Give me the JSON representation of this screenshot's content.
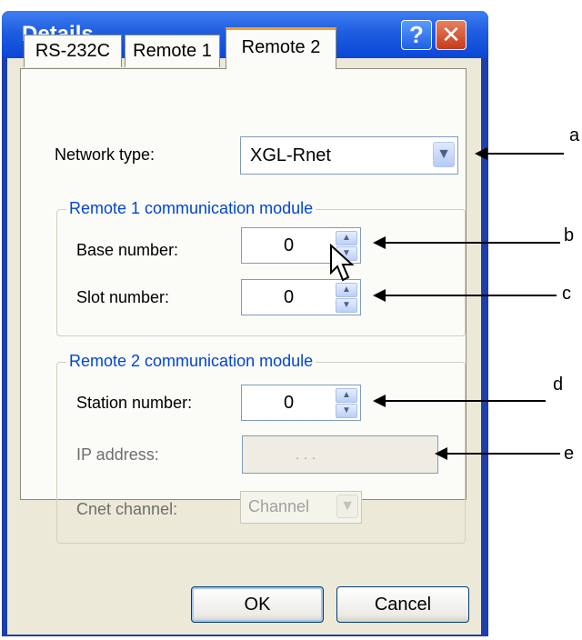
{
  "window": {
    "title": "Details",
    "help_button": "?",
    "close_button": "✕"
  },
  "tabs": [
    {
      "label": "RS-232C"
    },
    {
      "label": "Remote 1"
    },
    {
      "label": "Remote 2"
    }
  ],
  "network_type": {
    "label": "Network type:",
    "value": "XGL-Rnet"
  },
  "remote1": {
    "group_title": "Remote 1 communication module",
    "base": {
      "label": "Base number:",
      "value": "0"
    },
    "slot": {
      "label": "Slot number:",
      "value": "0"
    }
  },
  "remote2": {
    "group_title": "Remote 2 communication module",
    "station": {
      "label": "Station number:",
      "value": "0"
    },
    "ip": {
      "label": "IP address:",
      "dots": ".      .      ."
    },
    "cnet": {
      "label": "Cnet channel:",
      "value": "Channel"
    }
  },
  "buttons": {
    "ok": "OK",
    "cancel": "Cancel"
  },
  "annotations": [
    "a",
    "b",
    "c",
    "d",
    "e"
  ]
}
